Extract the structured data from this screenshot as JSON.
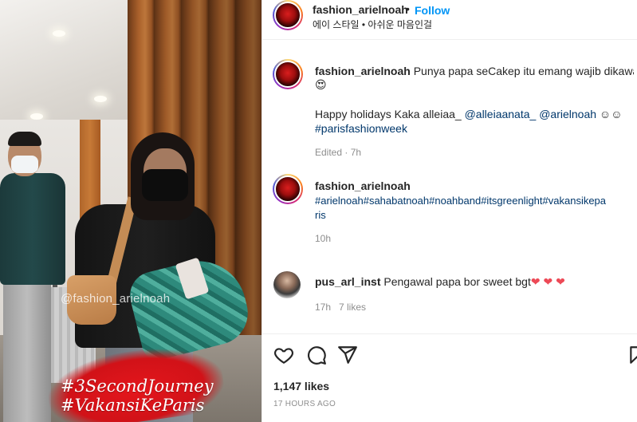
{
  "media": {
    "watermark": "@fashion_arielnoah",
    "sticker_line1": "#3SecondJourney",
    "sticker_line2": "#VakansiKeParis"
  },
  "header": {
    "username": "fashion_arielnoah",
    "dot": "•",
    "follow_label": "Follow",
    "audio_text": "에이 스타일 • 아쉬운 마음인걸"
  },
  "caption": {
    "username": "fashion_arielnoah",
    "line1": "Punya papa seCakep itu emang wajib dikawal 😍",
    "line2": "😍",
    "line3_text": "Happy holidays Kaka alleiaa_ ",
    "mention1": "@alleiaanata_",
    "mention2": "@arielnoah",
    "line3_emoji": "☺☺",
    "hashtag": "#parisfashionweek",
    "meta": "Edited · 7h"
  },
  "comment1": {
    "username": "fashion_arielnoah",
    "tags_line1": "#arielnoah#sahabatnoah#noahband#itsgreenlight#vakansikepa",
    "tags_line2": "ris",
    "time": "10h"
  },
  "comment2": {
    "username": "pus_arl_inst",
    "text": "Pengawal papa bor sweet bgt",
    "hearts": "❤ ❤ ❤",
    "time": "17h",
    "likes": "7 likes"
  },
  "actions": {
    "like_icon": "heart-icon",
    "comment_icon": "comment-icon",
    "share_icon": "share-icon",
    "save_icon": "bookmark-icon"
  },
  "stats": {
    "likes": "1,147 likes",
    "time_ago": "17 HOURS AGO"
  },
  "colors": {
    "follow": "#0095f6",
    "hashtag": "#00376b",
    "meta": "#8e8e8e",
    "heart": "#ed4956"
  }
}
